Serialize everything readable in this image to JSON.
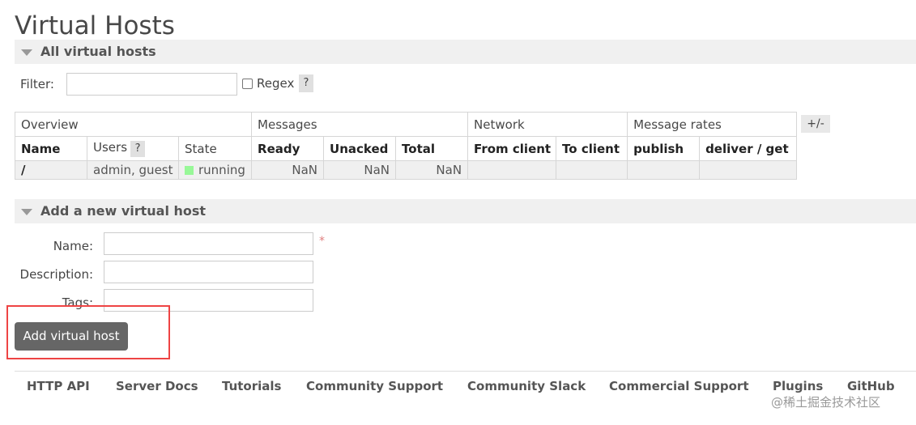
{
  "page_title": "Virtual Hosts",
  "all_section": {
    "title": "All virtual hosts",
    "filter_label": "Filter:",
    "filter_value": "",
    "regex_label": "Regex",
    "help": "?"
  },
  "table": {
    "groups": [
      "Overview",
      "Messages",
      "Network",
      "Message rates"
    ],
    "headers": [
      "Name",
      "Users",
      "State",
      "Ready",
      "Unacked",
      "Total",
      "From client",
      "To client",
      "publish",
      "deliver / get"
    ],
    "users_help": "?",
    "rows": [
      {
        "name": "/",
        "users": "admin, guest",
        "state": "running",
        "ready": "NaN",
        "unacked": "NaN",
        "total": "NaN",
        "from_client": "",
        "to_client": "",
        "publish": "",
        "deliver_get": ""
      }
    ],
    "plus_minus": "+/-"
  },
  "add_section": {
    "title": "Add a new virtual host",
    "name_label": "Name:",
    "description_label": "Description:",
    "tags_label": "Tags:",
    "required_mark": "*",
    "button_label": "Add virtual host"
  },
  "footer": {
    "links": [
      "HTTP API",
      "Server Docs",
      "Tutorials",
      "Community Support",
      "Community Slack",
      "Commercial Support",
      "Plugins",
      "GitHub"
    ]
  },
  "watermark": "@稀土掘金技术社区",
  "colors": {
    "state_running": "#98f898",
    "highlight": "#ee4444",
    "button": "#666666"
  }
}
